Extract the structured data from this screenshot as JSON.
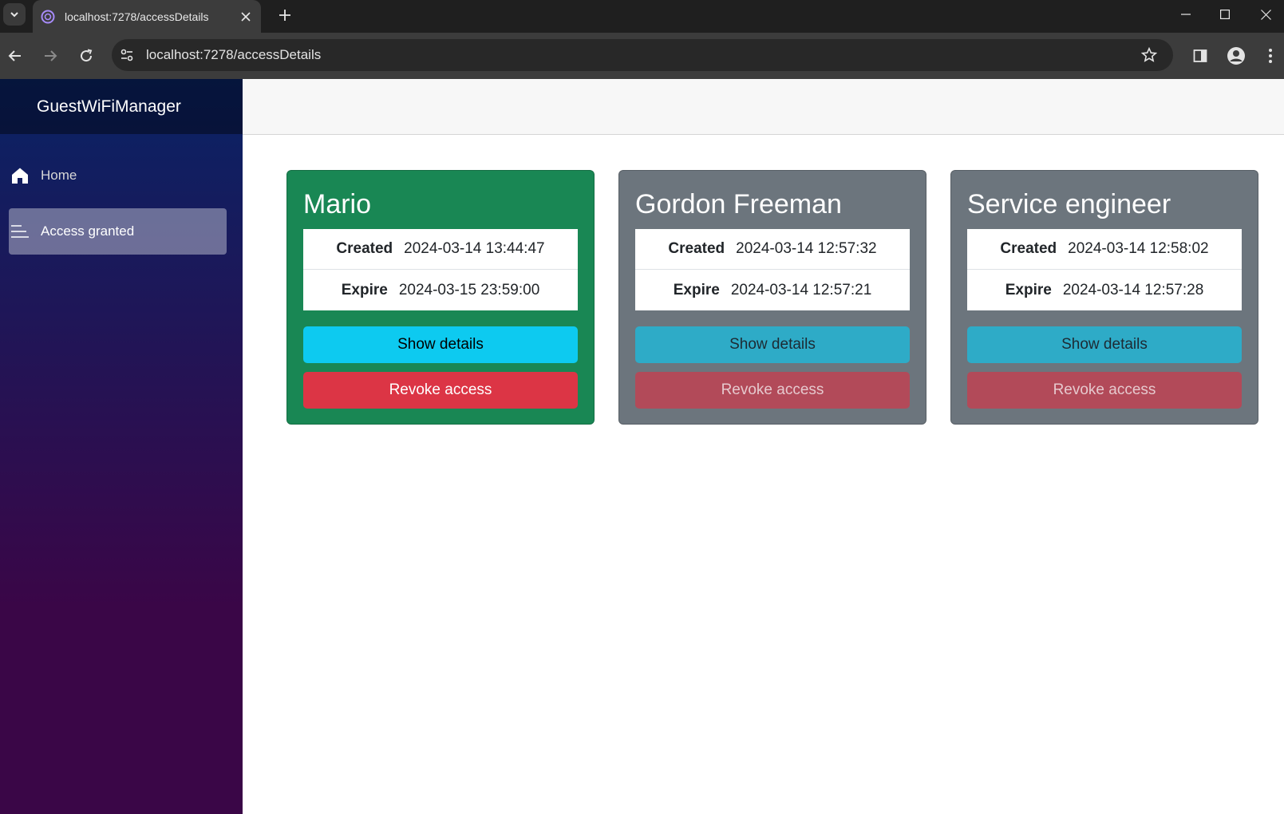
{
  "browser": {
    "tab_title": "localhost:7278/accessDetails",
    "url": "localhost:7278/accessDetails"
  },
  "app": {
    "brand": "GuestWiFiManager",
    "nav": [
      {
        "label": "Home",
        "icon": "home-icon"
      },
      {
        "label": "Access granted",
        "icon": "list-icon",
        "active": true
      }
    ]
  },
  "cards": [
    {
      "name": "Mario",
      "created_label": "Created",
      "created": "2024-03-14 13:44:47",
      "expire_label": "Expire",
      "expire": "2024-03-15 23:59:00",
      "details_label": "Show details",
      "revoke_label": "Revoke access",
      "status_color": "#198754"
    },
    {
      "name": "Gordon Freeman",
      "created_label": "Created",
      "created": "2024-03-14 12:57:32",
      "expire_label": "Expire",
      "expire": "2024-03-14 12:57:21",
      "details_label": "Show details",
      "revoke_label": "Revoke access",
      "status_color": "#6c757d"
    },
    {
      "name": "Service engineer",
      "created_label": "Created",
      "created": "2024-03-14 12:58:02",
      "expire_label": "Expire",
      "expire": "2024-03-14 12:57:28",
      "details_label": "Show details",
      "revoke_label": "Revoke access",
      "status_color": "#6c757d"
    }
  ]
}
